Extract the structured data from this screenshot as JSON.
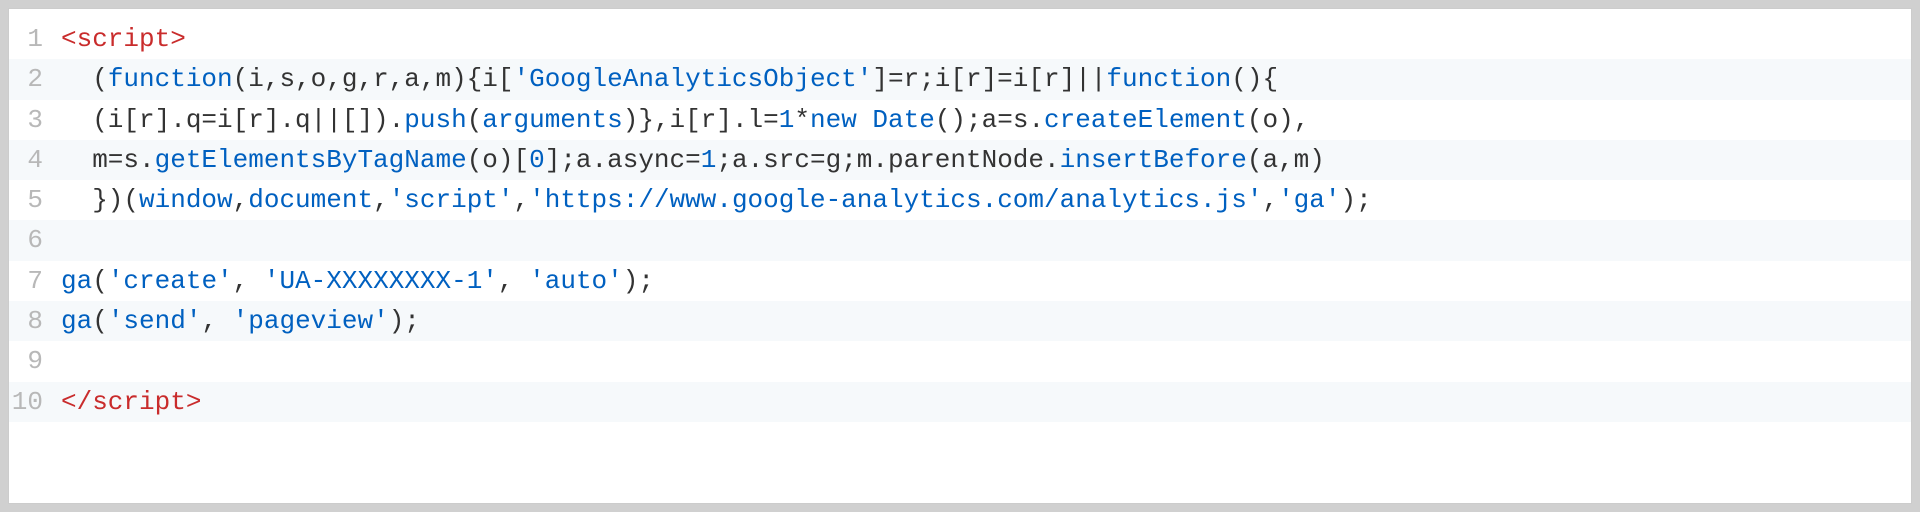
{
  "code": {
    "lines": [
      {
        "num": "1",
        "tokens": [
          {
            "cls": "tag",
            "t": "<script>"
          }
        ]
      },
      {
        "num": "2",
        "tokens": [
          {
            "cls": "plain",
            "t": "  ("
          },
          {
            "cls": "kw",
            "t": "function"
          },
          {
            "cls": "plain",
            "t": "(i,s,o,g,r,a,m){i["
          },
          {
            "cls": "str",
            "t": "'GoogleAnalyticsObject'"
          },
          {
            "cls": "plain",
            "t": "]=r;i[r]=i[r]||"
          },
          {
            "cls": "kw",
            "t": "function"
          },
          {
            "cls": "plain",
            "t": "(){"
          }
        ]
      },
      {
        "num": "3",
        "tokens": [
          {
            "cls": "plain",
            "t": "  (i[r].q=i[r].q||[])."
          },
          {
            "cls": "fn",
            "t": "push"
          },
          {
            "cls": "plain",
            "t": "("
          },
          {
            "cls": "kw",
            "t": "arguments"
          },
          {
            "cls": "plain",
            "t": ")},i[r].l="
          },
          {
            "cls": "cls",
            "t": "1"
          },
          {
            "cls": "plain",
            "t": "*"
          },
          {
            "cls": "kw",
            "t": "new"
          },
          {
            "cls": "plain",
            "t": " "
          },
          {
            "cls": "cls",
            "t": "Date"
          },
          {
            "cls": "plain",
            "t": "();a=s."
          },
          {
            "cls": "fn",
            "t": "createElement"
          },
          {
            "cls": "plain",
            "t": "(o),"
          }
        ]
      },
      {
        "num": "4",
        "tokens": [
          {
            "cls": "plain",
            "t": "  m=s."
          },
          {
            "cls": "fn",
            "t": "getElementsByTagName"
          },
          {
            "cls": "plain",
            "t": "(o)["
          },
          {
            "cls": "cls",
            "t": "0"
          },
          {
            "cls": "plain",
            "t": "];a.async="
          },
          {
            "cls": "cls",
            "t": "1"
          },
          {
            "cls": "plain",
            "t": ";a.src=g;m.parentNode."
          },
          {
            "cls": "fn",
            "t": "insertBefore"
          },
          {
            "cls": "plain",
            "t": "(a,m)"
          }
        ]
      },
      {
        "num": "5",
        "tokens": [
          {
            "cls": "plain",
            "t": "  })("
          },
          {
            "cls": "kw",
            "t": "window"
          },
          {
            "cls": "plain",
            "t": ","
          },
          {
            "cls": "kw",
            "t": "document"
          },
          {
            "cls": "plain",
            "t": ","
          },
          {
            "cls": "str",
            "t": "'script'"
          },
          {
            "cls": "plain",
            "t": ","
          },
          {
            "cls": "str",
            "t": "'https://www.google-analytics.com/analytics.js'"
          },
          {
            "cls": "plain",
            "t": ","
          },
          {
            "cls": "str",
            "t": "'ga'"
          },
          {
            "cls": "plain",
            "t": ");"
          }
        ]
      },
      {
        "num": "6",
        "tokens": [
          {
            "cls": "plain",
            "t": ""
          }
        ]
      },
      {
        "num": "7",
        "tokens": [
          {
            "cls": "fn",
            "t": "ga"
          },
          {
            "cls": "plain",
            "t": "("
          },
          {
            "cls": "str",
            "t": "'create'"
          },
          {
            "cls": "plain",
            "t": ", "
          },
          {
            "cls": "str",
            "t": "'UA-XXXXXXXX-1'"
          },
          {
            "cls": "plain",
            "t": ", "
          },
          {
            "cls": "str",
            "t": "'auto'"
          },
          {
            "cls": "plain",
            "t": ");"
          }
        ]
      },
      {
        "num": "8",
        "tokens": [
          {
            "cls": "fn",
            "t": "ga"
          },
          {
            "cls": "plain",
            "t": "("
          },
          {
            "cls": "str",
            "t": "'send'"
          },
          {
            "cls": "plain",
            "t": ", "
          },
          {
            "cls": "str",
            "t": "'pageview'"
          },
          {
            "cls": "plain",
            "t": ");"
          }
        ]
      },
      {
        "num": "9",
        "tokens": [
          {
            "cls": "plain",
            "t": ""
          }
        ]
      },
      {
        "num": "10",
        "tokens": [
          {
            "cls": "tag",
            "t": "</script>"
          }
        ]
      }
    ]
  }
}
